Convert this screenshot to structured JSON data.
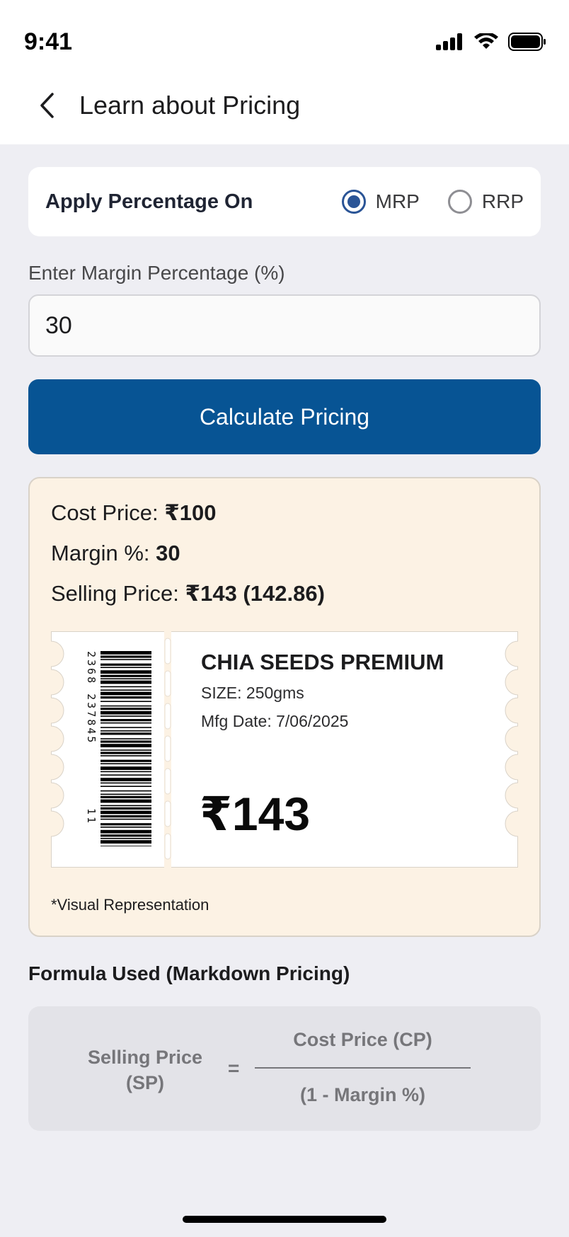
{
  "status_bar": {
    "time": "9:41"
  },
  "header": {
    "title": "Learn about Pricing"
  },
  "apply": {
    "label": "Apply Percentage On",
    "options": [
      {
        "label": "MRP",
        "selected": true
      },
      {
        "label": "RRP",
        "selected": false
      }
    ]
  },
  "margin_input": {
    "label": "Enter Margin Percentage (%)",
    "value": "30"
  },
  "calculate_button": {
    "label": "Calculate Pricing"
  },
  "result": {
    "cost_price_label": "Cost Price: ",
    "cost_price_value": "₹100",
    "margin_label": "Margin %: ",
    "margin_value": "30",
    "selling_price_label": "Selling Price: ",
    "selling_price_value": "₹143 (142.86)",
    "visual_note": "*Visual Representation"
  },
  "price_label": {
    "barcode_digits": "2368 237845",
    "barcode_digits_tail": "11",
    "product_name": "CHIA SEEDS PREMIUM",
    "size": "SIZE: 250gms",
    "mfg_date": "Mfg Date: 7/06/2025",
    "price": "₹143"
  },
  "formula": {
    "title": "Formula Used (Markdown Pricing)",
    "left_line1": "Selling Price",
    "left_line2": "(SP)",
    "equals": "=",
    "numerator": "Cost Price (CP)",
    "denominator": "(1 - Margin %)"
  },
  "colors": {
    "primary": "#075494",
    "radio": "#2a5496",
    "result_bg": "#fcf2e4"
  }
}
